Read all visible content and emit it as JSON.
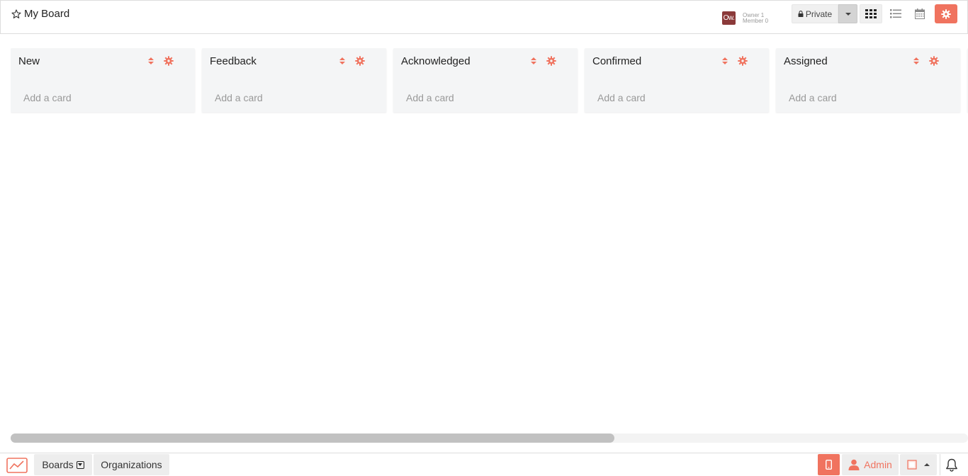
{
  "header": {
    "board_title": "My Board",
    "star_icon": "star-outline-icon",
    "member_avatar_initials": "Ow.",
    "owner_label": "Owner 1",
    "member_label": "Member 0",
    "privacy_label": "Private",
    "views": [
      "grid-view-icon",
      "list-view-icon",
      "calendar-view-icon"
    ],
    "settings_icon": "gear-icon"
  },
  "lists": [
    {
      "title": "New",
      "add_card": "Add a card"
    },
    {
      "title": "Feedback",
      "add_card": "Add a card"
    },
    {
      "title": "Acknowledged",
      "add_card": "Add a card"
    },
    {
      "title": "Confirmed",
      "add_card": "Add a card"
    },
    {
      "title": "Assigned",
      "add_card": "Add a card"
    }
  ],
  "footer": {
    "boards_label": "Boards",
    "organizations_label": "Organizations",
    "user_label": "Admin"
  },
  "colors": {
    "accent": "#f0735f",
    "list_bg": "#f4f5f6"
  }
}
